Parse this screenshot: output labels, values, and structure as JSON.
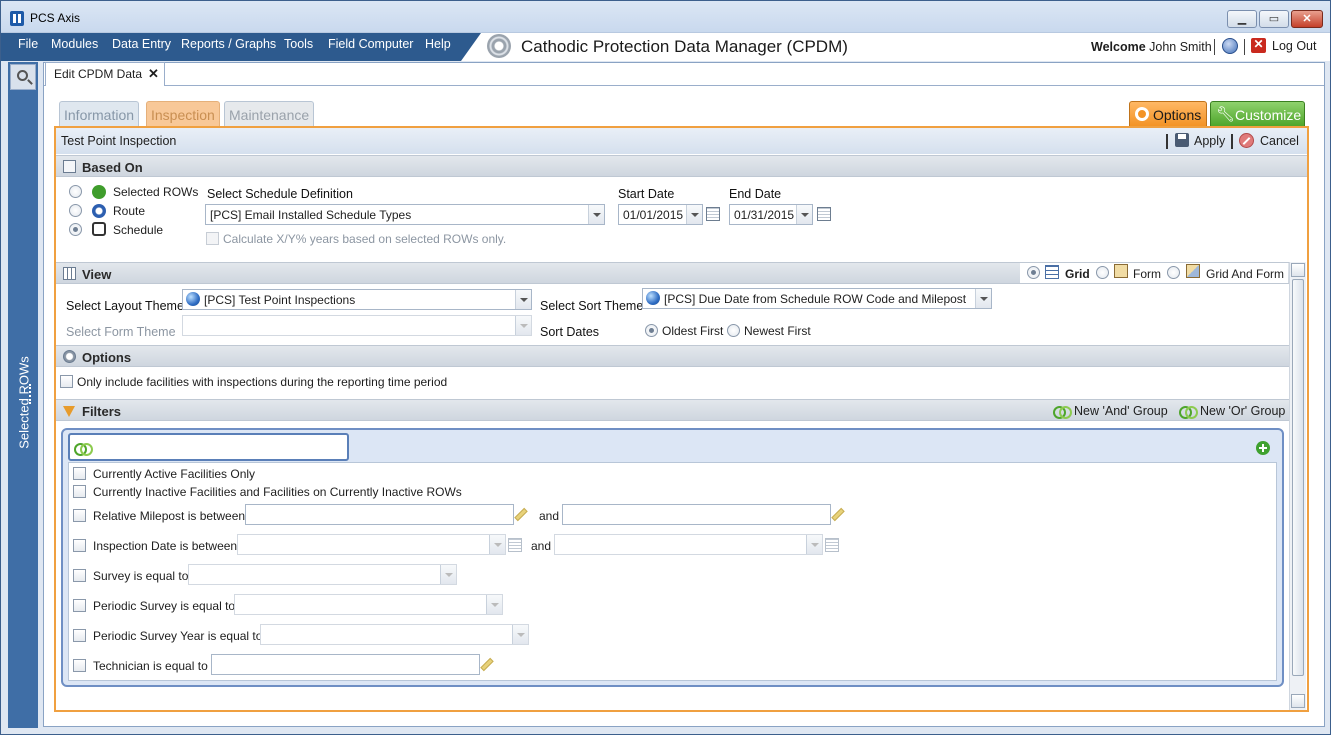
{
  "window": {
    "title": "PCS Axis",
    "minimize": "▁",
    "maximize": "▭",
    "close": "✕"
  },
  "menubar": {
    "items": [
      "File",
      "Modules",
      "Data Entry",
      "Reports / Graphs",
      "Tools",
      "Field Computer",
      "Help"
    ],
    "app_title": "Cathodic Protection Data Manager (CPDM)",
    "welcome_label": "Welcome",
    "user_name": "John Smith",
    "logout_label": "Log Out"
  },
  "sidebar": {
    "selected_rows_label": "Selected ROWs"
  },
  "doc_tab": {
    "label": "Edit CPDM Data",
    "close": "✕"
  },
  "tabs": [
    {
      "label": "Information",
      "state": "inactive"
    },
    {
      "label": "Inspection",
      "state": "active"
    },
    {
      "label": "Maintenance",
      "state": "inactive"
    }
  ],
  "options_button": {
    "label": "Options"
  },
  "customize_button": {
    "label": "Customize"
  },
  "panel": {
    "title": "Test Point Inspection",
    "apply_label": "Apply",
    "cancel_label": "Cancel"
  },
  "based_on": {
    "header": "Based On",
    "radios": [
      {
        "label": "Selected ROWs",
        "checked": false
      },
      {
        "label": "Route",
        "checked": false
      },
      {
        "label": "Schedule",
        "checked": true
      }
    ],
    "schedule_label": "Select Schedule Definition",
    "schedule_value": "[PCS] Email Installed Schedule Types",
    "start_label": "Start Date",
    "start_value": "01/01/2015",
    "end_label": "End Date",
    "end_value": "01/31/2015",
    "calc_label": "Calculate X/Y% years based on selected ROWs only."
  },
  "view": {
    "header": "View",
    "modes": [
      {
        "label": "Grid",
        "checked": true
      },
      {
        "label": "Form",
        "checked": false
      },
      {
        "label": "Grid And Form",
        "checked": false
      }
    ],
    "layout_label": "Select Layout Theme",
    "layout_value": "[PCS] Test Point Inspections",
    "form_label": "Select Form Theme",
    "form_value": "",
    "sort_label": "Select Sort Theme",
    "sort_value": "[PCS] Due Date from Schedule ROW Code and Milepost",
    "sort_dates_label": "Sort Dates",
    "oldest_label": "Oldest First",
    "newest_label": "Newest First",
    "oldest_checked": true
  },
  "options_section": {
    "header": "Options",
    "only_include_label": "Only include facilities with inspections during the reporting time period"
  },
  "filters": {
    "header": "Filters",
    "new_and_label": "New 'And' Group",
    "new_or_label": "New 'Or' Group",
    "group_name": "",
    "and_label": "and",
    "items": [
      {
        "label": "Currently Active Facilities Only"
      },
      {
        "label": "Currently Inactive Facilities and Facilities on Currently Inactive ROWs"
      },
      {
        "label": "Relative Milepost is between"
      },
      {
        "label": "Inspection Date is between"
      },
      {
        "label": "Survey is equal to"
      },
      {
        "label": "Periodic Survey is equal to"
      },
      {
        "label": "Periodic Survey Year is equal to"
      },
      {
        "label": "Technician is equal to"
      }
    ]
  },
  "colors": {
    "accent_orange": "#f39325",
    "accent_green": "#4ea52b",
    "menu_blue": "#2d5a8e"
  }
}
